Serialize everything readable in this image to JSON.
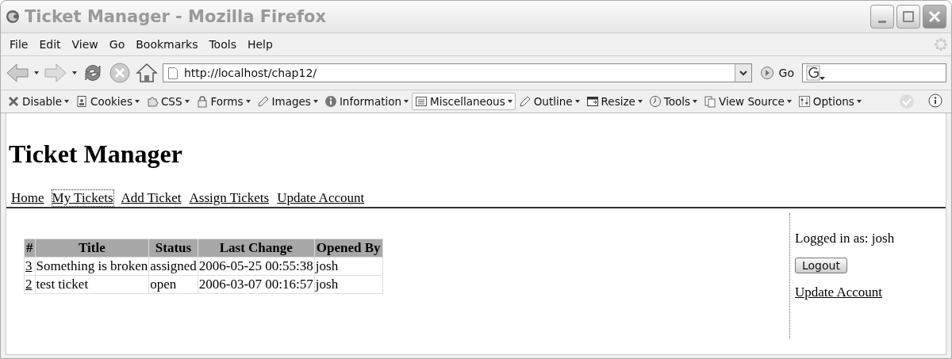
{
  "window": {
    "title": "Ticket Manager - Mozilla Firefox"
  },
  "menu": [
    "File",
    "Edit",
    "View",
    "Go",
    "Bookmarks",
    "Tools",
    "Help"
  ],
  "address_bar": {
    "value": "http://localhost/chap12/",
    "go_label": "Go"
  },
  "dev_toolbar": [
    {
      "label": "Disable",
      "selected": false
    },
    {
      "label": "Cookies",
      "selected": false
    },
    {
      "label": "CSS",
      "selected": false
    },
    {
      "label": "Forms",
      "selected": false
    },
    {
      "label": "Images",
      "selected": false
    },
    {
      "label": "Information",
      "selected": false
    },
    {
      "label": "Miscellaneous",
      "selected": true
    },
    {
      "label": "Outline",
      "selected": false
    },
    {
      "label": "Resize",
      "selected": false
    },
    {
      "label": "Tools",
      "selected": false
    },
    {
      "label": "View Source",
      "selected": false
    },
    {
      "label": "Options",
      "selected": false
    }
  ],
  "page": {
    "heading": "Ticket Manager",
    "nav": [
      {
        "label": "Home",
        "selected": false
      },
      {
        "label": "My Tickets",
        "selected": true
      },
      {
        "label": "Add Ticket",
        "selected": false
      },
      {
        "label": "Assign Tickets",
        "selected": false
      },
      {
        "label": "Update Account",
        "selected": false
      }
    ],
    "table": {
      "columns": [
        "#",
        "Title",
        "Status",
        "Last Change",
        "Opened By"
      ],
      "rows": [
        [
          "3",
          "Something is broken",
          "assigned",
          "2006-05-25 00:55:38",
          "josh"
        ],
        [
          "2",
          "test ticket",
          "open",
          "2006-03-07 00:16:57",
          "josh"
        ]
      ]
    },
    "sidebar": {
      "logged_in": "Logged in as: josh",
      "logout": "Logout",
      "link": "Update Account"
    }
  }
}
